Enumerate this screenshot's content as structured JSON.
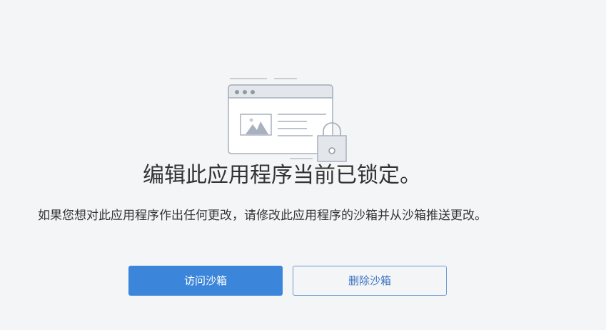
{
  "locked_page": {
    "title": "编辑此应用程序当前已锁定。",
    "description": "如果您想对此应用程序作出任何更改，请修改此应用程序的沙箱并从沙箱推送更改。",
    "primary_button_label": "访问沙箱",
    "secondary_button_label": "删除沙箱",
    "illustration_icon": "locked-browser-window-icon"
  },
  "colors": {
    "background": "#f4f5f7",
    "primary": "#3b86da",
    "secondary_border": "#6f9bd1",
    "secondary_text": "#3b73c4",
    "illustration_stroke": "#a8b1bd",
    "illustration_fill": "#e3e7ec"
  }
}
